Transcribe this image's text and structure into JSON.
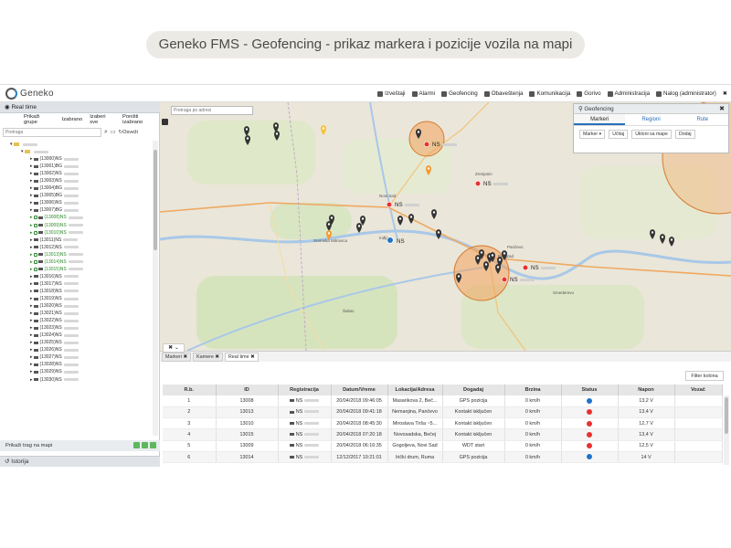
{
  "caption": "Geneko FMS - Geofencing - prikaz markera i pozicije vozila na mapi",
  "app": {
    "logo_text": "Geneko"
  },
  "nav": [
    {
      "label": "Izveštaji",
      "icon": "report-icon"
    },
    {
      "label": "Alarmi",
      "icon": "bell-icon"
    },
    {
      "label": "Geofencing",
      "icon": "map-pin-icon"
    },
    {
      "label": "Obaveštenja",
      "icon": "info-icon"
    },
    {
      "label": "Komunikacija",
      "icon": "mail-icon"
    },
    {
      "label": "Gorivo",
      "icon": "fuel-icon"
    },
    {
      "label": "Administracija",
      "icon": "gear-icon"
    },
    {
      "label": "Nalog (administrator)",
      "icon": "user-icon"
    }
  ],
  "left": {
    "title": "Real time",
    "tools": [
      "Prikaži grupe",
      "Izabrano",
      "Izaberi sve",
      "Poništi izabrano"
    ],
    "search_placeholder": "Pretraga",
    "refresh_label": "Osveži",
    "tree": [
      {
        "label": "",
        "type": "folder"
      },
      {
        "label": "",
        "type": "folder"
      },
      {
        "label": "(13000)NS",
        "green": false
      },
      {
        "label": "(13001)BG",
        "green": false
      },
      {
        "label": "(13002)NS",
        "green": false
      },
      {
        "label": "(13003)NS",
        "green": false
      },
      {
        "label": "(13004)BG",
        "green": false
      },
      {
        "label": "(13005)BG",
        "green": false
      },
      {
        "label": "(13006)NS",
        "green": false
      },
      {
        "label": "(13007)BG",
        "green": false
      },
      {
        "label": "(13008)NS",
        "green": true
      },
      {
        "label": "(13009)NS",
        "green": true
      },
      {
        "label": "(13010)NS",
        "green": true
      },
      {
        "label": "(13011)NS",
        "green": false
      },
      {
        "label": "(13012)NS",
        "green": false
      },
      {
        "label": "(13013)NS",
        "green": true
      },
      {
        "label": "(13014)NS",
        "green": true
      },
      {
        "label": "(13015)NS",
        "green": true
      },
      {
        "label": "(13016)NS",
        "green": false
      },
      {
        "label": "(13017)NS",
        "green": false
      },
      {
        "label": "(13018)NS",
        "green": false
      },
      {
        "label": "(13019)NS",
        "green": false
      },
      {
        "label": "(13020)NS",
        "green": false
      },
      {
        "label": "(13021)NS",
        "green": false
      },
      {
        "label": "(13022)NS",
        "green": false
      },
      {
        "label": "(13023)NS",
        "green": false
      },
      {
        "label": "(13024)NS",
        "green": false
      },
      {
        "label": "(13025)NS",
        "green": false
      },
      {
        "label": "(13026)NS",
        "green": false
      },
      {
        "label": "(13027)NS",
        "green": false
      },
      {
        "label": "(13028)NS",
        "green": false
      },
      {
        "label": "(13029)NS",
        "green": false
      },
      {
        "label": "(13030)NS",
        "green": false
      }
    ],
    "trail_label": "Prikaži trag na mapi",
    "history_title": "Istorija"
  },
  "map": {
    "search_placeholder": "Pretraga po adresi",
    "ns_label": "NS",
    "place_labels": [
      "Novi Sad",
      "Beograd",
      "Pančevo",
      "Zrenjanin",
      "Ruma",
      "Smederevo",
      "Sremska Mitrovica",
      "Šabac",
      "Inđija"
    ]
  },
  "geofencing": {
    "title": "Geofencing",
    "tabs": [
      "Markeri",
      "Regioni",
      "Rute"
    ],
    "marker_select": "Marker",
    "load_btn": "Učitaj",
    "remove_btn": "Ukloni sa mape",
    "add_btn": "Dodaj"
  },
  "bottom_tabs": [
    "Markeri",
    "Kamere",
    "Real time"
  ],
  "filter_label": "Filter kolona",
  "table": {
    "headers": [
      "R.b.",
      "ID",
      "Registracija",
      "Datum/Vreme",
      "Lokacija/Adresa",
      "Dogadaj",
      "Brzina",
      "Status",
      "Napon",
      "Vozač"
    ],
    "rows": [
      {
        "rb": "1",
        "id": "13008",
        "reg": "NS",
        "dt": "20/04/2018 09:46:05",
        "loc": "Masarikova 2, Beč...",
        "ev": "GPS pozicija",
        "speed": "0 km/h",
        "status": "info",
        "volt": "13,2 V",
        "driver": ""
      },
      {
        "rb": "2",
        "id": "13013",
        "reg": "NS",
        "dt": "20/04/2018 09:41:18",
        "loc": "Nemanjina, Pančevo",
        "ev": "Kontakt isključen",
        "speed": "0 km/h",
        "status": "off",
        "volt": "13,4 V",
        "driver": ""
      },
      {
        "rb": "3",
        "id": "13010",
        "reg": "NS",
        "dt": "20/04/2018 08:45:30",
        "loc": "Miroslava Tirša ~5...",
        "ev": "Kontakt isključen",
        "speed": "0 km/h",
        "status": "off",
        "volt": "12,7 V",
        "driver": ""
      },
      {
        "rb": "4",
        "id": "13015",
        "reg": "NS",
        "dt": "20/04/2018 07:20:18",
        "loc": "Novosadska, Bečej",
        "ev": "Kontakt isključen",
        "speed": "0 km/h",
        "status": "off",
        "volt": "13,4 V",
        "driver": ""
      },
      {
        "rb": "5",
        "id": "13009",
        "reg": "NS",
        "dt": "20/04/2018 06:16:35",
        "loc": "Gogoljeva, Novi Sad",
        "ev": "WDT start",
        "speed": "0 km/h",
        "status": "off",
        "volt": "12,5 V",
        "driver": ""
      },
      {
        "rb": "6",
        "id": "13014",
        "reg": "NS",
        "dt": "12/12/2017 19:21:01",
        "loc": "Irički drum, Ruma",
        "ev": "GPS pozicija",
        "speed": "0 km/h",
        "status": "info",
        "volt": "14 V",
        "driver": ""
      }
    ]
  },
  "colors": {
    "accent": "#2a6ebb",
    "marker": "#333333",
    "vehicle": "#e8312f",
    "fence_fill": "#f3a25c",
    "status_off": "#e8312f",
    "status_info": "#1f74c9"
  }
}
